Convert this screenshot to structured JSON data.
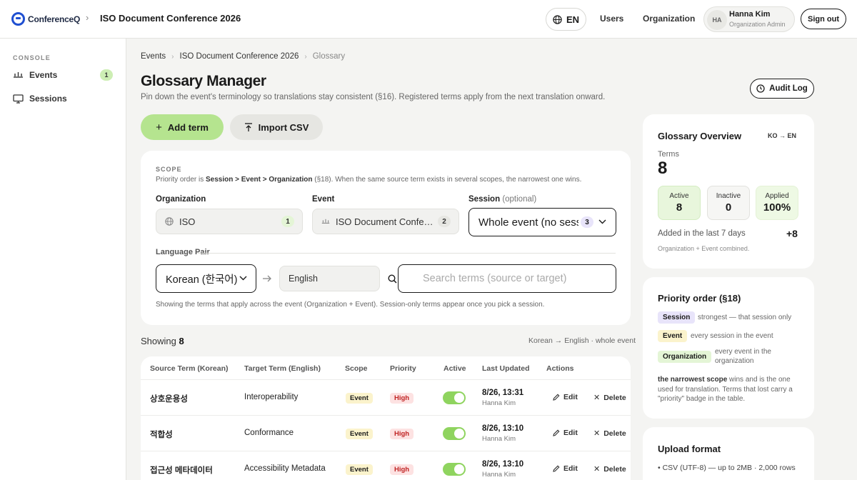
{
  "header": {
    "logo_text": "ConferenceQ",
    "conference_title": "ISO Document Conference 2026",
    "lang_label": "EN",
    "nav": [
      "Users",
      "Organization"
    ],
    "user": {
      "initials": "HA",
      "name": "Hanna Kim",
      "role": "Organization Admin"
    },
    "signout_label": "Sign out"
  },
  "sidebar": {
    "section": "CONSOLE",
    "items": [
      {
        "label": "Events",
        "badge": "1"
      },
      {
        "label": "Sessions"
      }
    ]
  },
  "breadcrumb": [
    "Events",
    "ISO Document Conference 2026",
    "Glossary"
  ],
  "page": {
    "title": "Glossary Manager",
    "subtitle": "Pin down the event's terminology so translations stay consistent (§16). Registered terms apply from the next translation onward.",
    "audit_label": "Audit Log",
    "add_label": "Add term",
    "import_label": "Import CSV"
  },
  "scope": {
    "section": "SCOPE",
    "note_prefix": "Priority order is ",
    "note_order": "Session > Event > Organization",
    "note_suffix": " (§18). When the same source term exists in several scopes, the narrowest one wins.",
    "org_label": "Organization",
    "org_value": "ISO",
    "org_count": "1",
    "event_label": "Event",
    "event_value": "ISO Document Confe…",
    "event_count": "2",
    "session_label": "Session",
    "session_optional": "(optional)",
    "session_value": "Whole event (no sessi",
    "session_count": "3",
    "language_pair_label": "Language Pair",
    "source_lang": "Korean (한국어)",
    "target_lang": "English",
    "search_placeholder": "Search terms (source or target)",
    "showing_note": "Showing the terms that apply across the event (Organization + Event). Session-only terms appear once you pick a session."
  },
  "results": {
    "showing_label": "Showing",
    "showing_count": "8",
    "context": "Korean → English · whole event"
  },
  "table": {
    "headers": [
      "Source Term (Korean)",
      "Target Term (English)",
      "Scope",
      "Priority",
      "Active",
      "Last Updated",
      "Actions"
    ],
    "edit_label": "Edit",
    "delete_label": "Delete",
    "rows": [
      {
        "source": "상호운용성",
        "target": "Interoperability",
        "scope": "Event",
        "priority": "High",
        "date": "8/26, 13:31",
        "user": "Hanna Kim"
      },
      {
        "source": "적합성",
        "target": "Conformance",
        "scope": "Event",
        "priority": "High",
        "date": "8/26, 13:10",
        "user": "Hanna Kim"
      },
      {
        "source": "접근성 메타데이터",
        "target": "Accessibility Metadata",
        "scope": "Event",
        "priority": "High",
        "date": "8/26, 13:10",
        "user": "Hanna Kim"
      }
    ]
  },
  "overview": {
    "title": "Glossary Overview",
    "pair": "KO → EN",
    "terms_label": "Terms",
    "terms_value": "8",
    "stats": [
      {
        "label": "Active",
        "value": "8"
      },
      {
        "label": "Inactive",
        "value": "0"
      },
      {
        "label": "Applied",
        "value": "100%"
      }
    ],
    "added_label": "Added in the last 7 days",
    "added_value": "+8",
    "combined_note": "Organization + Event combined."
  },
  "priority": {
    "title": "Priority order (§18)",
    "items": [
      {
        "tag": "Session",
        "desc": "strongest — that session only"
      },
      {
        "tag": "Event",
        "desc": "every session in the event"
      },
      {
        "tag": "Organization",
        "desc": "every event in the organization"
      }
    ],
    "note_bold": "the narrowest scope",
    "note_rest": " wins and is the one used for translation. Terms that lost carry a \"priority\" badge in the table."
  },
  "upload": {
    "title": "Upload format",
    "item": "CSV (UTF-8) — up to 2MB · 2,000 rows"
  },
  "colors": {
    "accent_green": "#b5e48f",
    "brand_blue": "#1f4fd1",
    "toggle_on": "#8fd45f",
    "high_red": "#c02424"
  }
}
